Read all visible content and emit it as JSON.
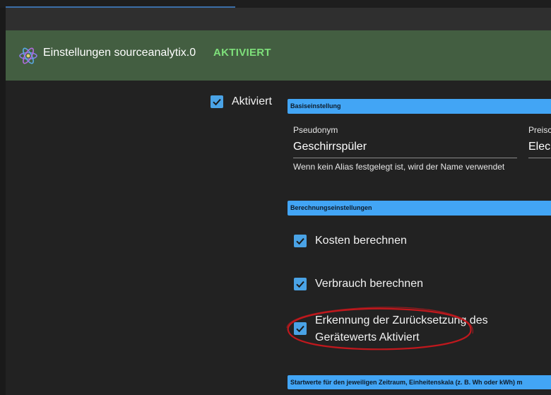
{
  "header": {
    "title": "Einstellungen sourceanalytix.0",
    "status": "AKTIVIERT",
    "logo_icon": "atom-icon"
  },
  "main": {
    "enabled_label": "Aktiviert",
    "sections": {
      "basic": "Basiseinstellung",
      "calculation": "Berechnungseinstellungen",
      "start_values": "Startwerte für den jeweiligen Zeitraum, Einheitenskala (z. B. Wh oder kWh) m"
    },
    "alias": {
      "label": "Pseudonym",
      "value": "Geschirrspüler",
      "helper": "Wenn kein Alias festgelegt ist, wird der Name verwendet"
    },
    "price": {
      "label": "Preisc",
      "value": "Elec"
    },
    "options": {
      "calc_costs": "Kosten berechnen",
      "calc_consumption": "Verbrauch berechnen",
      "reset_detection": "Erkennung der Zurücksetzung des Gerätewerts Aktiviert"
    }
  },
  "colors": {
    "header_bg": "#435e41",
    "status_green": "#7ee07a",
    "accent_blue": "#42a5f5",
    "checkbox_blue": "#4aa3e6",
    "highlight_red": "#c0181d"
  }
}
